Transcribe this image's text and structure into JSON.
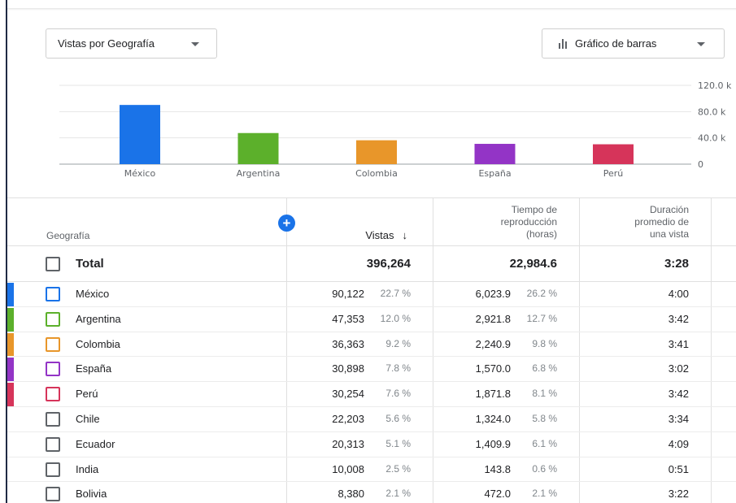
{
  "controls": {
    "metric_dropdown": "Vistas por Geografía",
    "chart_type_dropdown": "Gráfico de barras"
  },
  "chart_data": {
    "type": "bar",
    "categories": [
      "México",
      "Argentina",
      "Colombia",
      "España",
      "Perú"
    ],
    "values": [
      90122,
      47353,
      36363,
      30898,
      30254
    ],
    "colors": [
      "#1a73e8",
      "#5cb02b",
      "#e8962a",
      "#9334c6",
      "#d6345a"
    ],
    "ylim": [
      0,
      120000
    ],
    "yticks": [
      0,
      40000,
      80000,
      120000
    ],
    "ytick_labels": [
      "0",
      "40.0 k",
      "80.0 k",
      "120.0 k"
    ],
    "y_axis_side": "right",
    "grid": true
  },
  "table": {
    "headers": {
      "geografia": "Geografía",
      "vistas": "Vistas",
      "tiempo_line1": "Tiempo de",
      "tiempo_line2": "reproducción",
      "tiempo_line3": "(horas)",
      "duracion_line1": "Duración",
      "duracion_line2": "promedio de",
      "duracion_line3": "una vista",
      "sort_arrow": "↓"
    },
    "add_button": "+",
    "total": {
      "label": "Total",
      "vistas": "396,264",
      "tiempo": "22,984.6",
      "duracion": "3:28"
    },
    "rows": [
      {
        "name": "México",
        "vistas": "90,122",
        "vistas_pct": "22.7 %",
        "tiempo": "6,023.9",
        "tiempo_pct": "26.2 %",
        "duracion": "4:00",
        "color": "#1a73e8"
      },
      {
        "name": "Argentina",
        "vistas": "47,353",
        "vistas_pct": "12.0 %",
        "tiempo": "2,921.8",
        "tiempo_pct": "12.7 %",
        "duracion": "3:42",
        "color": "#5cb02b"
      },
      {
        "name": "Colombia",
        "vistas": "36,363",
        "vistas_pct": "9.2 %",
        "tiempo": "2,240.9",
        "tiempo_pct": "9.8 %",
        "duracion": "3:41",
        "color": "#e8962a"
      },
      {
        "name": "España",
        "vistas": "30,898",
        "vistas_pct": "7.8 %",
        "tiempo": "1,570.0",
        "tiempo_pct": "6.8 %",
        "duracion": "3:02",
        "color": "#9334c6"
      },
      {
        "name": "Perú",
        "vistas": "30,254",
        "vistas_pct": "7.6 %",
        "tiempo": "1,871.8",
        "tiempo_pct": "8.1 %",
        "duracion": "3:42",
        "color": "#d6345a"
      },
      {
        "name": "Chile",
        "vistas": "22,203",
        "vistas_pct": "5.6 %",
        "tiempo": "1,324.0",
        "tiempo_pct": "5.8 %",
        "duracion": "3:34",
        "color": ""
      },
      {
        "name": "Ecuador",
        "vistas": "20,313",
        "vistas_pct": "5.1 %",
        "tiempo": "1,409.9",
        "tiempo_pct": "6.1 %",
        "duracion": "4:09",
        "color": ""
      },
      {
        "name": "India",
        "vistas": "10,008",
        "vistas_pct": "2.5 %",
        "tiempo": "143.8",
        "tiempo_pct": "0.6 %",
        "duracion": "0:51",
        "color": ""
      },
      {
        "name": "Bolivia",
        "vistas": "8,380",
        "vistas_pct": "2.1 %",
        "tiempo": "472.0",
        "tiempo_pct": "2.1 %",
        "duracion": "3:22",
        "color": ""
      }
    ]
  }
}
